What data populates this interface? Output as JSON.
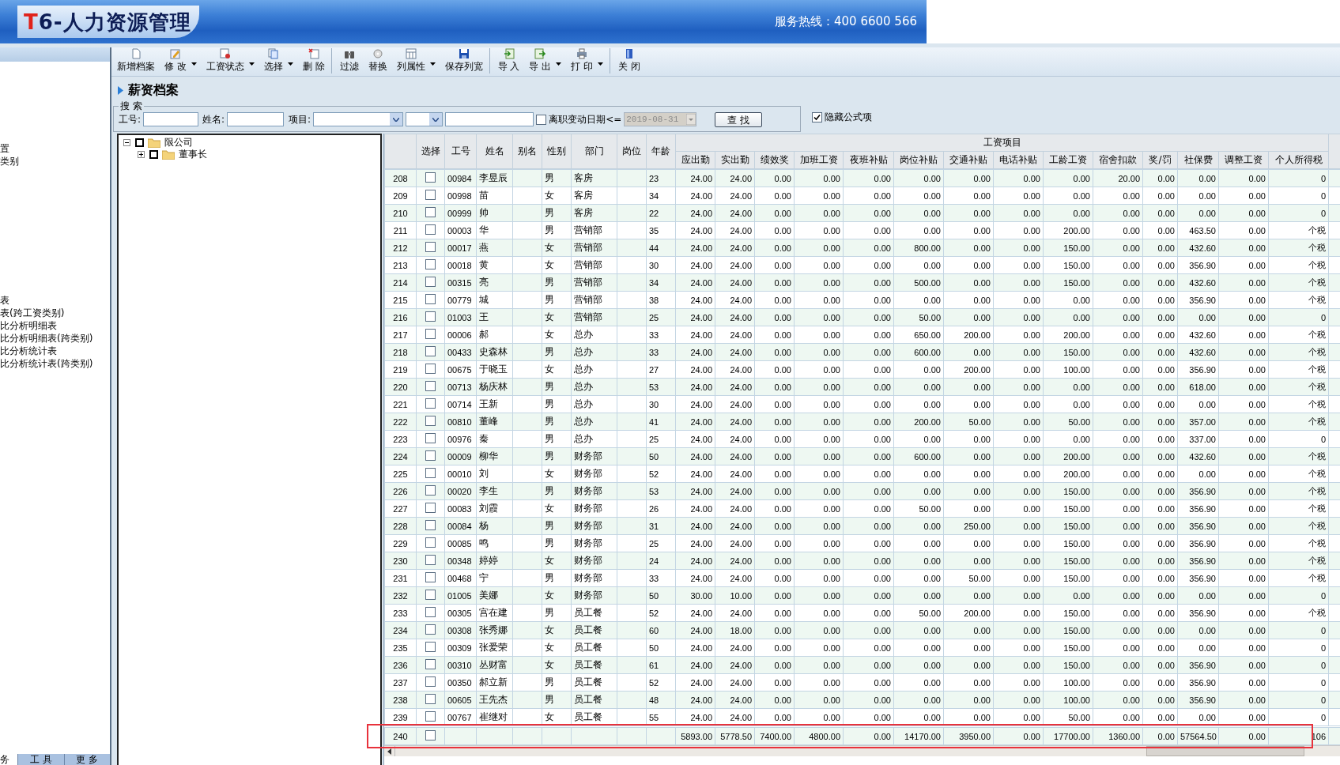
{
  "header": {
    "logo_mark": "T",
    "title": "6-人力资源管理",
    "hotline": "服务热线：400 6600 566"
  },
  "nav": {
    "items": [
      {
        "label": "置",
        "selected": false
      },
      {
        "label": "类别",
        "selected": false
      },
      {
        "label": "表",
        "selected": false
      },
      {
        "label": "表(跨工资类别)",
        "selected": false
      },
      {
        "label": "比分析明细表",
        "selected": false
      },
      {
        "label": "比分析明细表(跨类别)",
        "selected": false
      },
      {
        "label": "比分析统计表",
        "selected": false
      },
      {
        "label": "比分析统计表(跨类别)",
        "selected": false
      }
    ],
    "tabs": [
      {
        "label": "务",
        "selected": true
      },
      {
        "label": "工 具",
        "selected": false
      },
      {
        "label": "更 多",
        "selected": false
      }
    ]
  },
  "toolbar": [
    {
      "label": "新增档案",
      "kind": "new",
      "dropdown": false,
      "separator_before": false
    },
    {
      "label": "修 改",
      "kind": "edit",
      "dropdown": true,
      "separator_before": false
    },
    {
      "label": "工资状态",
      "kind": "status",
      "dropdown": true,
      "separator_before": false
    },
    {
      "label": "选择",
      "kind": "select",
      "dropdown": true,
      "separator_before": false
    },
    {
      "label": "删 除",
      "kind": "delete",
      "dropdown": false,
      "separator_before": false
    },
    {
      "label": "过滤",
      "kind": "filter",
      "dropdown": false,
      "separator_before": true
    },
    {
      "label": "替换",
      "kind": "replace",
      "dropdown": false,
      "separator_before": false
    },
    {
      "label": "列属性",
      "kind": "columns",
      "dropdown": true,
      "separator_before": false
    },
    {
      "label": "保存列宽",
      "kind": "save",
      "dropdown": false,
      "separator_before": false
    },
    {
      "label": "导 入",
      "kind": "import",
      "dropdown": false,
      "separator_before": true
    },
    {
      "label": "导 出",
      "kind": "export",
      "dropdown": true,
      "separator_before": false
    },
    {
      "label": "打 印",
      "kind": "print",
      "dropdown": true,
      "separator_before": false
    },
    {
      "label": "关 闭",
      "kind": "close",
      "dropdown": false,
      "separator_before": true
    }
  ],
  "page_title": "薪资档案",
  "search": {
    "legend": "搜 索",
    "id_label": "工号:",
    "name_label": "姓名:",
    "item_label": "项目:",
    "date_filter": {
      "label": "离职变动日期<=",
      "checked": false,
      "value": "2019-08-31",
      "disabled": true
    },
    "button": "查 找"
  },
  "hide_formula": {
    "label": "隐藏公式项",
    "checked": true
  },
  "tree": [
    {
      "label": "限公司",
      "expanded": true,
      "checked": false,
      "children": [
        {
          "label": "董事长",
          "expanded": false,
          "checked": false
        }
      ]
    }
  ],
  "table": {
    "columns": [
      "选择",
      "工号",
      "姓名",
      "别名",
      "性别",
      "部门",
      "岗位",
      "年龄"
    ],
    "group": "工资项目",
    "group_columns": [
      "应出勤",
      "实出勤",
      "绩效奖",
      "加班工资",
      "夜班补贴",
      "岗位补贴",
      "交通补贴",
      "电话补贴",
      "工龄工资",
      "宿舍扣款",
      "奖/罚",
      "社保费",
      "调整工资",
      "个人所得税"
    ],
    "rows": [
      {
        "index": "208",
        "checked": false,
        "id": "00984",
        "name": "李昱辰",
        "gender": "男",
        "dept": "客房",
        "age": "23",
        "values": [
          "24.00",
          "24.00",
          "0.00",
          "0.00",
          "0.00",
          "0.00",
          "0.00",
          "0.00",
          "0.00",
          "20.00",
          "0.00",
          "0.00",
          "0.00",
          "0"
        ]
      },
      {
        "index": "209",
        "checked": false,
        "id": "00998",
        "name": "苗",
        "gender": "女",
        "dept": "客房",
        "age": "34",
        "values": [
          "24.00",
          "24.00",
          "0.00",
          "0.00",
          "0.00",
          "0.00",
          "0.00",
          "0.00",
          "0.00",
          "0.00",
          "0.00",
          "0.00",
          "0.00",
          "0"
        ]
      },
      {
        "index": "210",
        "checked": false,
        "id": "00999",
        "name": "帅",
        "gender": "男",
        "dept": "客房",
        "age": "22",
        "values": [
          "24.00",
          "24.00",
          "0.00",
          "0.00",
          "0.00",
          "0.00",
          "0.00",
          "0.00",
          "0.00",
          "0.00",
          "0.00",
          "0.00",
          "0.00",
          "0"
        ]
      },
      {
        "index": "211",
        "checked": false,
        "id": "00003",
        "name": "华",
        "gender": "男",
        "dept": "营销部",
        "age": "35",
        "values": [
          "24.00",
          "24.00",
          "0.00",
          "0.00",
          "0.00",
          "0.00",
          "0.00",
          "0.00",
          "200.00",
          "0.00",
          "0.00",
          "463.50",
          "0.00",
          "个税"
        ]
      },
      {
        "index": "212",
        "checked": false,
        "id": "00017",
        "name": "燕",
        "gender": "女",
        "dept": "营销部",
        "age": "44",
        "values": [
          "24.00",
          "24.00",
          "0.00",
          "0.00",
          "0.00",
          "800.00",
          "0.00",
          "0.00",
          "150.00",
          "0.00",
          "0.00",
          "432.60",
          "0.00",
          "个税"
        ]
      },
      {
        "index": "213",
        "checked": false,
        "id": "00018",
        "name": "黄",
        "gender": "女",
        "dept": "营销部",
        "age": "30",
        "values": [
          "24.00",
          "24.00",
          "0.00",
          "0.00",
          "0.00",
          "0.00",
          "0.00",
          "0.00",
          "150.00",
          "0.00",
          "0.00",
          "356.90",
          "0.00",
          "个税"
        ]
      },
      {
        "index": "214",
        "checked": false,
        "id": "00315",
        "name": "亮",
        "gender": "男",
        "dept": "营销部",
        "age": "34",
        "values": [
          "24.00",
          "24.00",
          "0.00",
          "0.00",
          "0.00",
          "500.00",
          "0.00",
          "0.00",
          "150.00",
          "0.00",
          "0.00",
          "432.60",
          "0.00",
          "个税"
        ]
      },
      {
        "index": "215",
        "checked": false,
        "id": "00779",
        "name": "城",
        "gender": "男",
        "dept": "营销部",
        "age": "38",
        "values": [
          "24.00",
          "24.00",
          "0.00",
          "0.00",
          "0.00",
          "0.00",
          "0.00",
          "0.00",
          "0.00",
          "0.00",
          "0.00",
          "356.90",
          "0.00",
          "个税"
        ]
      },
      {
        "index": "216",
        "checked": false,
        "id": "01003",
        "name": "王",
        "gender": "女",
        "dept": "营销部",
        "age": "25",
        "values": [
          "24.00",
          "24.00",
          "0.00",
          "0.00",
          "0.00",
          "50.00",
          "0.00",
          "0.00",
          "0.00",
          "0.00",
          "0.00",
          "0.00",
          "0.00",
          "0"
        ]
      },
      {
        "index": "217",
        "checked": false,
        "id": "00006",
        "name": "郝",
        "gender": "女",
        "dept": "总办",
        "age": "33",
        "values": [
          "24.00",
          "24.00",
          "0.00",
          "0.00",
          "0.00",
          "650.00",
          "200.00",
          "0.00",
          "200.00",
          "0.00",
          "0.00",
          "432.60",
          "0.00",
          "个税"
        ]
      },
      {
        "index": "218",
        "checked": false,
        "id": "00433",
        "name": "史森林",
        "gender": "男",
        "dept": "总办",
        "age": "33",
        "values": [
          "24.00",
          "24.00",
          "0.00",
          "0.00",
          "0.00",
          "600.00",
          "0.00",
          "0.00",
          "150.00",
          "0.00",
          "0.00",
          "432.60",
          "0.00",
          "个税"
        ]
      },
      {
        "index": "219",
        "checked": false,
        "id": "00675",
        "name": "于晓玉",
        "gender": "女",
        "dept": "总办",
        "age": "27",
        "values": [
          "24.00",
          "24.00",
          "0.00",
          "0.00",
          "0.00",
          "0.00",
          "200.00",
          "0.00",
          "100.00",
          "0.00",
          "0.00",
          "356.90",
          "0.00",
          "个税"
        ]
      },
      {
        "index": "220",
        "checked": false,
        "id": "00713",
        "name": "杨庆林",
        "gender": "男",
        "dept": "总办",
        "age": "53",
        "values": [
          "24.00",
          "24.00",
          "0.00",
          "0.00",
          "0.00",
          "0.00",
          "0.00",
          "0.00",
          "0.00",
          "0.00",
          "0.00",
          "618.00",
          "0.00",
          "个税"
        ]
      },
      {
        "index": "221",
        "checked": false,
        "id": "00714",
        "name": "王新",
        "gender": "男",
        "dept": "总办",
        "age": "30",
        "values": [
          "24.00",
          "24.00",
          "0.00",
          "0.00",
          "0.00",
          "0.00",
          "0.00",
          "0.00",
          "0.00",
          "0.00",
          "0.00",
          "0.00",
          "0.00",
          "个税"
        ]
      },
      {
        "index": "222",
        "checked": false,
        "id": "00810",
        "name": "董峰",
        "gender": "男",
        "dept": "总办",
        "age": "41",
        "values": [
          "24.00",
          "24.00",
          "0.00",
          "0.00",
          "0.00",
          "200.00",
          "50.00",
          "0.00",
          "50.00",
          "0.00",
          "0.00",
          "357.00",
          "0.00",
          "个税"
        ]
      },
      {
        "index": "223",
        "checked": false,
        "id": "00976",
        "name": "秦",
        "gender": "男",
        "dept": "总办",
        "age": "25",
        "values": [
          "24.00",
          "24.00",
          "0.00",
          "0.00",
          "0.00",
          "0.00",
          "0.00",
          "0.00",
          "0.00",
          "0.00",
          "0.00",
          "337.00",
          "0.00",
          "0"
        ]
      },
      {
        "index": "224",
        "checked": false,
        "id": "00009",
        "name": "柳华",
        "gender": "男",
        "dept": "财务部",
        "age": "50",
        "values": [
          "24.00",
          "24.00",
          "0.00",
          "0.00",
          "0.00",
          "600.00",
          "0.00",
          "0.00",
          "200.00",
          "0.00",
          "0.00",
          "432.60",
          "0.00",
          "个税"
        ]
      },
      {
        "index": "225",
        "checked": false,
        "id": "00010",
        "name": "刘",
        "gender": "女",
        "dept": "财务部",
        "age": "52",
        "values": [
          "24.00",
          "24.00",
          "0.00",
          "0.00",
          "0.00",
          "0.00",
          "0.00",
          "0.00",
          "200.00",
          "0.00",
          "0.00",
          "0.00",
          "0.00",
          "个税"
        ]
      },
      {
        "index": "226",
        "checked": false,
        "id": "00020",
        "name": "李生",
        "gender": "男",
        "dept": "财务部",
        "age": "53",
        "values": [
          "24.00",
          "24.00",
          "0.00",
          "0.00",
          "0.00",
          "0.00",
          "0.00",
          "0.00",
          "150.00",
          "0.00",
          "0.00",
          "356.90",
          "0.00",
          "个税"
        ]
      },
      {
        "index": "227",
        "checked": false,
        "id": "00083",
        "name": "刘霞",
        "gender": "女",
        "dept": "财务部",
        "age": "26",
        "values": [
          "24.00",
          "24.00",
          "0.00",
          "0.00",
          "0.00",
          "50.00",
          "0.00",
          "0.00",
          "150.00",
          "0.00",
          "0.00",
          "356.90",
          "0.00",
          "个税"
        ]
      },
      {
        "index": "228",
        "checked": false,
        "id": "00084",
        "name": "杨",
        "gender": "男",
        "dept": "财务部",
        "age": "31",
        "values": [
          "24.00",
          "24.00",
          "0.00",
          "0.00",
          "0.00",
          "0.00",
          "250.00",
          "0.00",
          "150.00",
          "0.00",
          "0.00",
          "356.90",
          "0.00",
          "个税"
        ]
      },
      {
        "index": "229",
        "checked": false,
        "id": "00085",
        "name": "鸣",
        "gender": "男",
        "dept": "财务部",
        "age": "25",
        "values": [
          "24.00",
          "24.00",
          "0.00",
          "0.00",
          "0.00",
          "0.00",
          "0.00",
          "0.00",
          "150.00",
          "0.00",
          "0.00",
          "356.90",
          "0.00",
          "个税"
        ]
      },
      {
        "index": "230",
        "checked": false,
        "id": "00348",
        "name": "婷婷",
        "gender": "女",
        "dept": "财务部",
        "age": "24",
        "values": [
          "24.00",
          "24.00",
          "0.00",
          "0.00",
          "0.00",
          "0.00",
          "0.00",
          "0.00",
          "150.00",
          "0.00",
          "0.00",
          "356.90",
          "0.00",
          "个税"
        ]
      },
      {
        "index": "231",
        "checked": false,
        "id": "00468",
        "name": "宁",
        "gender": "男",
        "dept": "财务部",
        "age": "33",
        "values": [
          "24.00",
          "24.00",
          "0.00",
          "0.00",
          "0.00",
          "0.00",
          "50.00",
          "0.00",
          "150.00",
          "0.00",
          "0.00",
          "356.90",
          "0.00",
          "个税"
        ]
      },
      {
        "index": "232",
        "checked": false,
        "id": "01005",
        "name": "美娜",
        "gender": "女",
        "dept": "财务部",
        "age": "50",
        "values": [
          "30.00",
          "10.00",
          "0.00",
          "0.00",
          "0.00",
          "0.00",
          "0.00",
          "0.00",
          "0.00",
          "0.00",
          "0.00",
          "0.00",
          "0.00",
          "0"
        ]
      },
      {
        "index": "233",
        "checked": false,
        "id": "00305",
        "name": "宫在建",
        "gender": "男",
        "dept": "员工餐",
        "age": "52",
        "values": [
          "24.00",
          "24.00",
          "0.00",
          "0.00",
          "0.00",
          "50.00",
          "200.00",
          "0.00",
          "150.00",
          "0.00",
          "0.00",
          "356.90",
          "0.00",
          "个税"
        ]
      },
      {
        "index": "234",
        "checked": false,
        "id": "00308",
        "name": "张秀娜",
        "gender": "女",
        "dept": "员工餐",
        "age": "60",
        "values": [
          "24.00",
          "18.00",
          "0.00",
          "0.00",
          "0.00",
          "0.00",
          "0.00",
          "0.00",
          "150.00",
          "0.00",
          "0.00",
          "0.00",
          "0.00",
          "0"
        ]
      },
      {
        "index": "235",
        "checked": false,
        "id": "00309",
        "name": "张爱荣",
        "gender": "女",
        "dept": "员工餐",
        "age": "50",
        "values": [
          "24.00",
          "24.00",
          "0.00",
          "0.00",
          "0.00",
          "0.00",
          "0.00",
          "0.00",
          "150.00",
          "0.00",
          "0.00",
          "0.00",
          "0.00",
          "0"
        ]
      },
      {
        "index": "236",
        "checked": false,
        "id": "00310",
        "name": "丛财富",
        "gender": "女",
        "dept": "员工餐",
        "age": "61",
        "values": [
          "24.00",
          "24.00",
          "0.00",
          "0.00",
          "0.00",
          "0.00",
          "0.00",
          "0.00",
          "150.00",
          "0.00",
          "0.00",
          "356.90",
          "0.00",
          "0"
        ]
      },
      {
        "index": "237",
        "checked": false,
        "id": "00350",
        "name": "郝立新",
        "gender": "男",
        "dept": "员工餐",
        "age": "52",
        "values": [
          "24.00",
          "24.00",
          "0.00",
          "0.00",
          "0.00",
          "0.00",
          "0.00",
          "0.00",
          "100.00",
          "0.00",
          "0.00",
          "356.90",
          "0.00",
          "0"
        ]
      },
      {
        "index": "238",
        "checked": false,
        "id": "00605",
        "name": "王先杰",
        "gender": "男",
        "dept": "员工餐",
        "age": "48",
        "values": [
          "24.00",
          "24.00",
          "0.00",
          "0.00",
          "0.00",
          "0.00",
          "0.00",
          "0.00",
          "100.00",
          "0.00",
          "0.00",
          "356.90",
          "0.00",
          "0"
        ]
      },
      {
        "index": "239",
        "checked": false,
        "id": "00767",
        "name": "崔继对",
        "gender": "女",
        "dept": "员工餐",
        "age": "55",
        "values": [
          "24.00",
          "24.00",
          "0.00",
          "0.00",
          "0.00",
          "0.00",
          "0.00",
          "0.00",
          "50.00",
          "0.00",
          "0.00",
          "0.00",
          "0.00",
          "0"
        ]
      }
    ],
    "total": {
      "index": "240",
      "checked": false,
      "values": [
        "5893.00",
        "5778.50",
        "7400.00",
        "4800.00",
        "0.00",
        "14170.00",
        "3950.00",
        "0.00",
        "17700.00",
        "1360.00",
        "0.00",
        "57564.50",
        "0.00",
        "106"
      ]
    }
  }
}
